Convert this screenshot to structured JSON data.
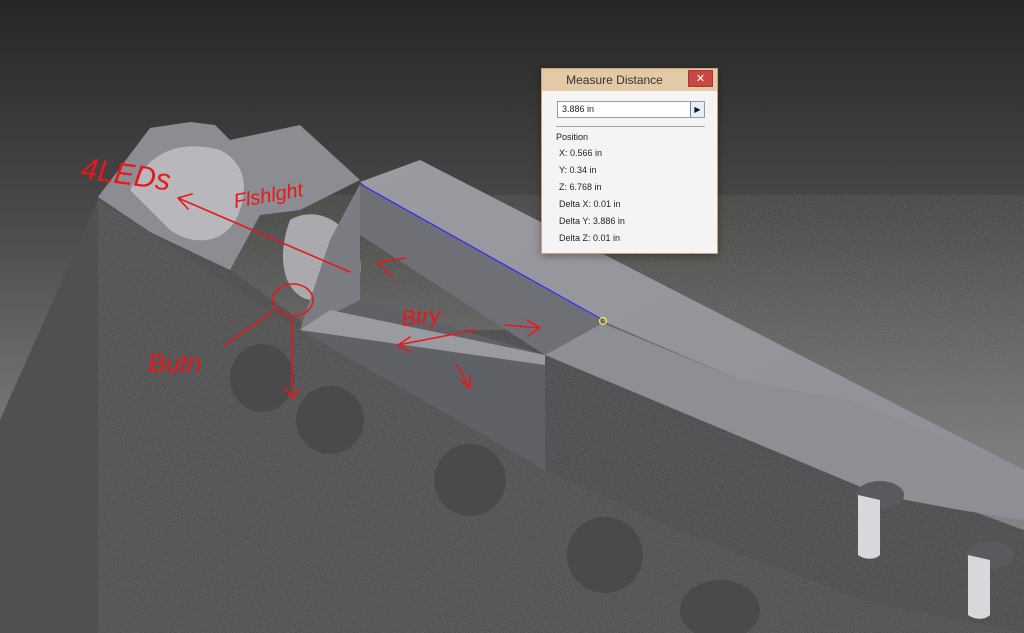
{
  "viewport": {
    "annotations": [
      "4LEDs",
      "Flshlght",
      "Butn",
      "Btry"
    ]
  },
  "dialog": {
    "title": "Measure Distance",
    "close_icon": "close-icon",
    "value": "3.886 in",
    "section": "Position",
    "rows": [
      "X: 0.566 in",
      "Y: 0.34 in",
      "Z: 6.768 in",
      "Delta X: 0.01 in",
      "Delta Y: 3.886 in",
      "Delta Z: 0.01 in"
    ]
  },
  "colors": {
    "annotation": "#e8171a",
    "measure_line": "#2a2aff",
    "dialog_titlebar": "#e4c9a7",
    "close_button": "#c9483f"
  }
}
